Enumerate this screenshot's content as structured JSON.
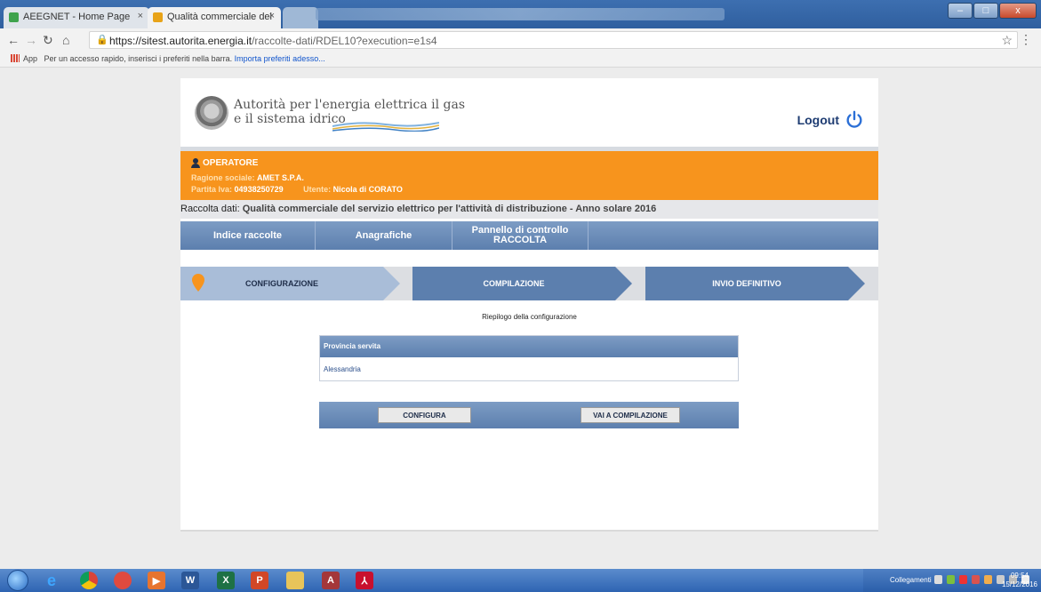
{
  "browser": {
    "tabs": [
      {
        "label": "AEEGNET - Home Page",
        "close": "×"
      },
      {
        "label": "Qualità commerciale del",
        "close": "×"
      }
    ],
    "url_host": "https://sitest.autorita.energia.it",
    "url_path": "/raccolte-dati/RDEL10?execution=e1s4",
    "bookmarks_apps": "App",
    "bookmarks_hint": "Per un accesso rapido, inserisci i preferiti nella barra.",
    "bookmarks_import": "Importa preferiti adesso..."
  },
  "header": {
    "logo_line1": "Autorità per l'energia elettrica il gas",
    "logo_line2": "e il sistema idrico",
    "logout": "Logout"
  },
  "operator": {
    "title": "OPERATORE",
    "ragione_label": "Ragione sociale:",
    "ragione_value": "AMET S.P.A.",
    "piva_label": "Partita Iva:",
    "piva_value": "04938250729",
    "utente_label": "Utente:",
    "utente_value": "Nicola di CORATO"
  },
  "raccolta": {
    "label": "Raccolta dati:",
    "title": "Qualità commerciale del servizio elettrico per l'attività di distribuzione - Anno solare 2016"
  },
  "menu": {
    "indice": "Indice raccolte",
    "anagrafiche": "Anagrafiche",
    "pannello_line1": "Pannello di controllo",
    "pannello_line2": "RACCOLTA"
  },
  "steps": {
    "configurazione": "CONFIGURAZIONE",
    "compilazione": "COMPILAZIONE",
    "invio": "INVIO DEFINITIVO"
  },
  "summary": {
    "title": "Riepilogo della configurazione",
    "column": "Provincia servita",
    "value": "Alessandria"
  },
  "actions": {
    "configura": "CONFIGURA",
    "vai": "VAI A COMPILAZIONE"
  },
  "taskbar": {
    "tray_label": "Collegamenti",
    "time": "09:54",
    "date": "15/12/2016"
  },
  "colors": {
    "orange": "#f7941d",
    "navy": "#1e3c72",
    "step_blue": "#5c7fae",
    "step_light": "#a9bdd8"
  }
}
